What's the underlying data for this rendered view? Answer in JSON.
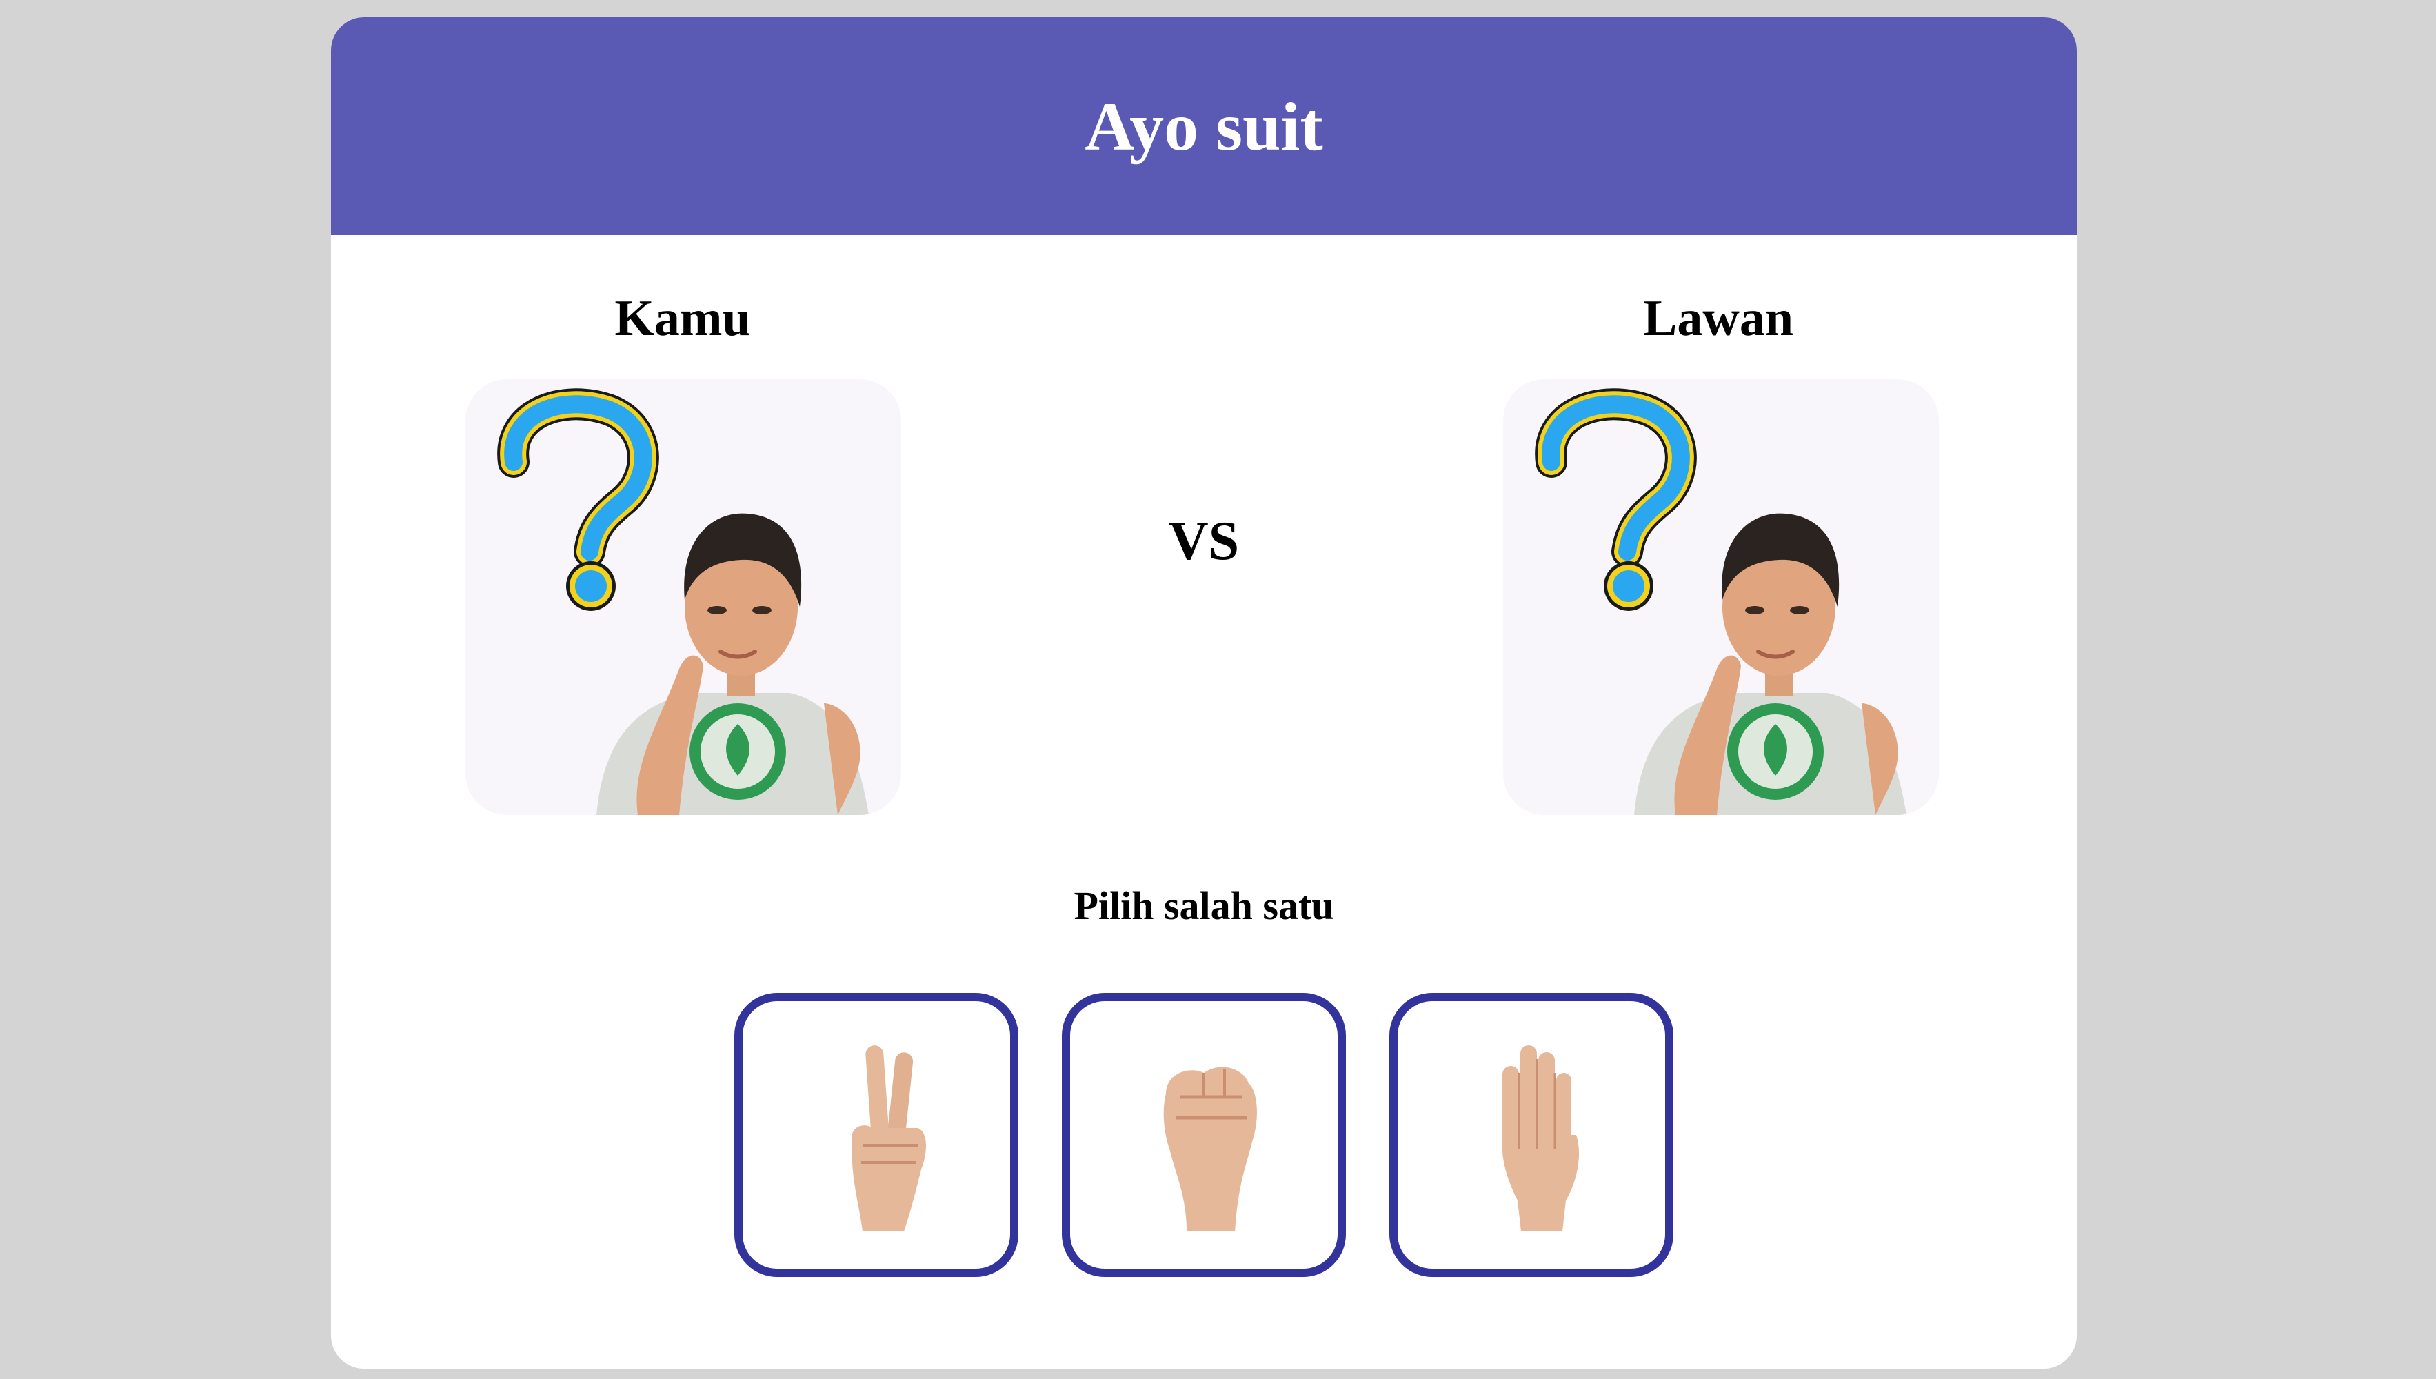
{
  "header": {
    "title": "Ayo suit"
  },
  "players": {
    "you_label": "Kamu",
    "opponent_label": "Lawan",
    "you_avatar": "thinking-avatar-question-mark",
    "opponent_avatar": "thinking-avatar-question-mark"
  },
  "versus_label": "VS",
  "prompt": "Pilih salah satu",
  "choices": [
    {
      "name": "scissors",
      "icon": "peace-hand-icon"
    },
    {
      "name": "rock",
      "icon": "fist-hand-icon"
    },
    {
      "name": "paper",
      "icon": "open-palm-icon"
    }
  ],
  "colors": {
    "background": "#d4d4d4",
    "header": "#5a5ab5",
    "choice_border": "#33339c",
    "avatar_bg": "#f8f6fa"
  }
}
